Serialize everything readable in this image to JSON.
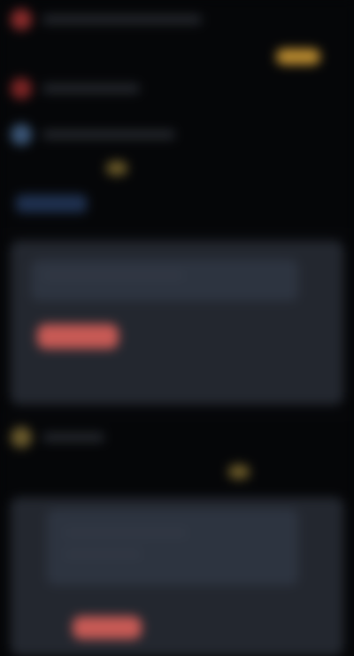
{
  "items": [],
  "cards": []
}
